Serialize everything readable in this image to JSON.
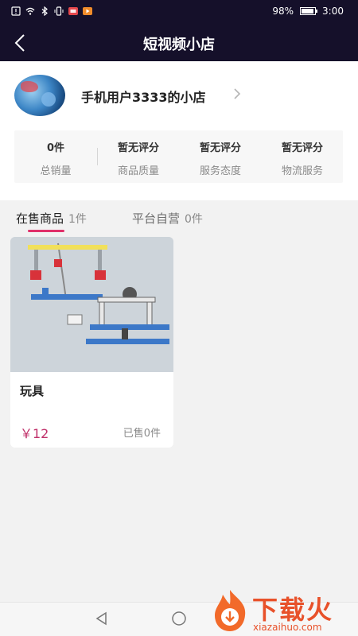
{
  "status_bar": {
    "battery": "98%",
    "time": "3:00"
  },
  "header": {
    "title": "短视频小店",
    "back_icon": "chevron-left-icon"
  },
  "shop": {
    "name": "手机用户3333的小店",
    "stats": [
      {
        "value": "0件",
        "label": "总销量"
      },
      {
        "value": "暂无评分",
        "label": "商品质量"
      },
      {
        "value": "暂无评分",
        "label": "服务态度"
      },
      {
        "value": "暂无评分",
        "label": "物流服务"
      }
    ]
  },
  "tabs": [
    {
      "name": "在售商品",
      "count": "1件",
      "active": true
    },
    {
      "name": "平台自营",
      "count": "0件",
      "active": false
    }
  ],
  "products": [
    {
      "title": "玩具",
      "price": "￥12",
      "sold": "已售0件"
    }
  ],
  "watermark": {
    "text": "下载火",
    "url": "xiazaihuo.com"
  },
  "colors": {
    "header_bg": "#15102a",
    "accent": "#e0306a",
    "price": "#c0306a",
    "watermark": "#e8512a"
  }
}
